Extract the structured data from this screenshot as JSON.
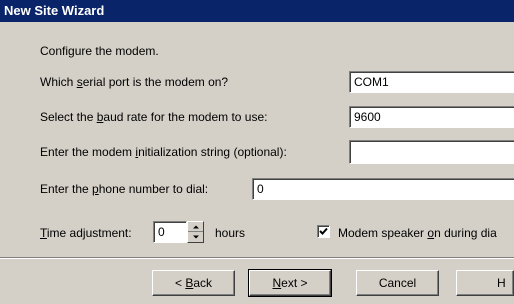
{
  "window": {
    "title": "New Site Wizard"
  },
  "heading": "Configure the modem.",
  "serial_port": {
    "label_pre": "Which ",
    "label_access": "s",
    "label_post": "erial port is the modem on?",
    "value": "COM1"
  },
  "baud_rate": {
    "label_pre": "Select the ",
    "label_access": "b",
    "label_post": "aud rate for the modem to use:",
    "value": "9600"
  },
  "init_string": {
    "label_pre": "Enter the modem ",
    "label_access": "i",
    "label_post": "nitialization string (optional):",
    "value": ""
  },
  "phone_number": {
    "label_pre": "Enter the ",
    "label_access": "p",
    "label_post": "hone number to dial:",
    "value": "0"
  },
  "time_adjust": {
    "label_access": "T",
    "label_post": "ime adjustment:",
    "value": "0",
    "units": "hours"
  },
  "speaker": {
    "checked": true,
    "label_pre": "Modem speaker ",
    "label_access": "o",
    "label_post": "n during dia"
  },
  "buttons": {
    "back_pre": "< ",
    "back_access": "B",
    "back_post": "ack",
    "next_access": "N",
    "next_post": "ext >",
    "cancel": "Cancel",
    "help": "H"
  }
}
